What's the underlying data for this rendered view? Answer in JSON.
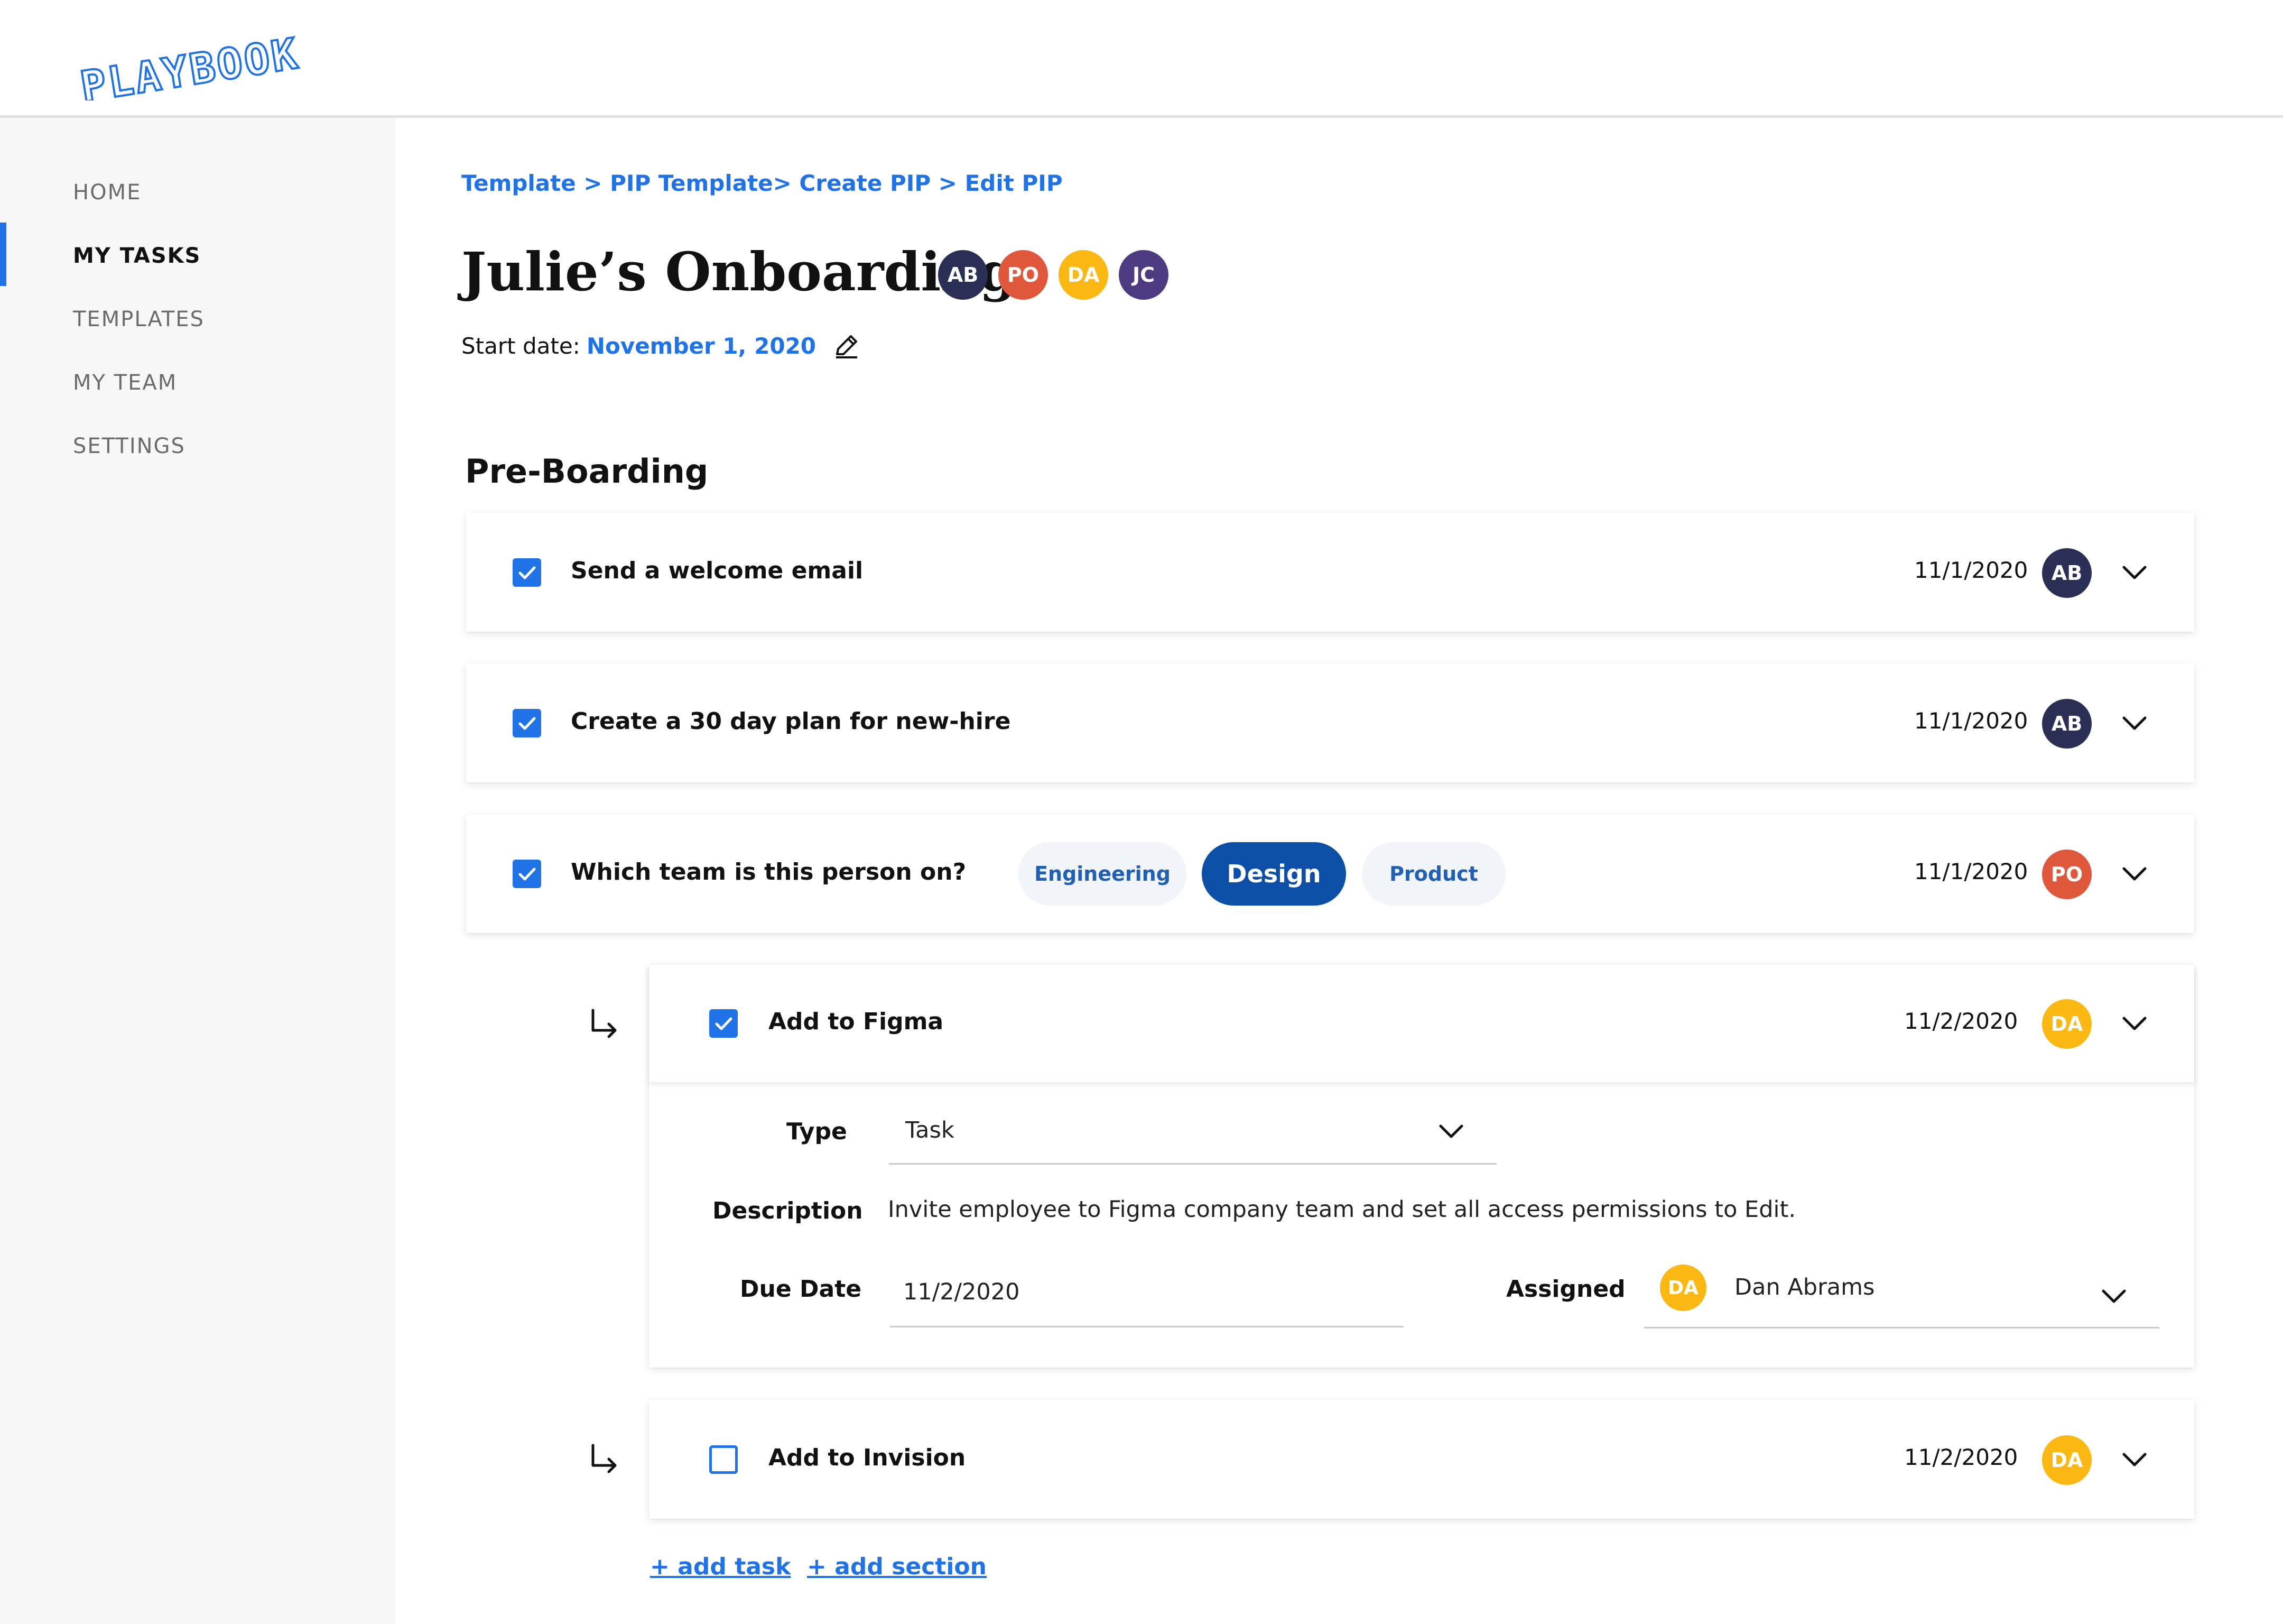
{
  "app": {
    "logo_text": "PLAYBOOK"
  },
  "sidebar": {
    "items": [
      {
        "label": "HOME",
        "active": false
      },
      {
        "label": "MY TASKS",
        "active": true
      },
      {
        "label": "TEMPLATES",
        "active": false
      },
      {
        "label": "MY TEAM",
        "active": false
      },
      {
        "label": "SETTINGS",
        "active": false
      }
    ]
  },
  "breadcrumb": {
    "text": "Template > PIP Template> Create PIP > Edit PIP"
  },
  "page": {
    "title": "Julie’s Onboarding",
    "collaborators": [
      "AB",
      "PO",
      "DA",
      "JC"
    ],
    "start_date_label": "Start date:",
    "start_date_value": "November 1, 2020"
  },
  "section": {
    "title": "Pre-Boarding",
    "tasks": [
      {
        "title": "Send a welcome email",
        "date": "11/1/2020",
        "assignee": "AB",
        "checked": true
      },
      {
        "title": "Create a 30 day plan for new-hire",
        "date": "11/1/2020",
        "assignee": "AB",
        "checked": true
      },
      {
        "title": "Which team is this person on?",
        "date": "11/1/2020",
        "assignee": "PO",
        "checked": true,
        "options": [
          "Engineering",
          "Design",
          "Product"
        ],
        "selected_option": "Design"
      }
    ],
    "subtasks": [
      {
        "title": "Add to Figma",
        "date": "11/2/2020",
        "assignee": "DA",
        "checked": true,
        "expanded": true
      },
      {
        "title": "Add to Invision",
        "date": "11/2/2020",
        "assignee": "DA",
        "checked": false,
        "expanded": false
      }
    ],
    "detail": {
      "type_label": "Type",
      "type_value": "Task",
      "description_label": "Description",
      "description_value": "Invite employee to Figma company team and set all access permissions to Edit.",
      "due_date_label": "Due Date",
      "due_date_value": "11/2/2020",
      "assigned_label": "Assigned",
      "assigned_initials": "DA",
      "assigned_name": "Dan Abrams"
    }
  },
  "actions": {
    "add_task": "+ add task",
    "add_section": "+ add section"
  },
  "colors": {
    "accent": "#1f73e6",
    "pill_selected": "#0d4fa6",
    "avatar_ab": "#2b2f55",
    "avatar_po": "#e0583c",
    "avatar_da": "#fbb812",
    "avatar_jc": "#4e3a80"
  }
}
